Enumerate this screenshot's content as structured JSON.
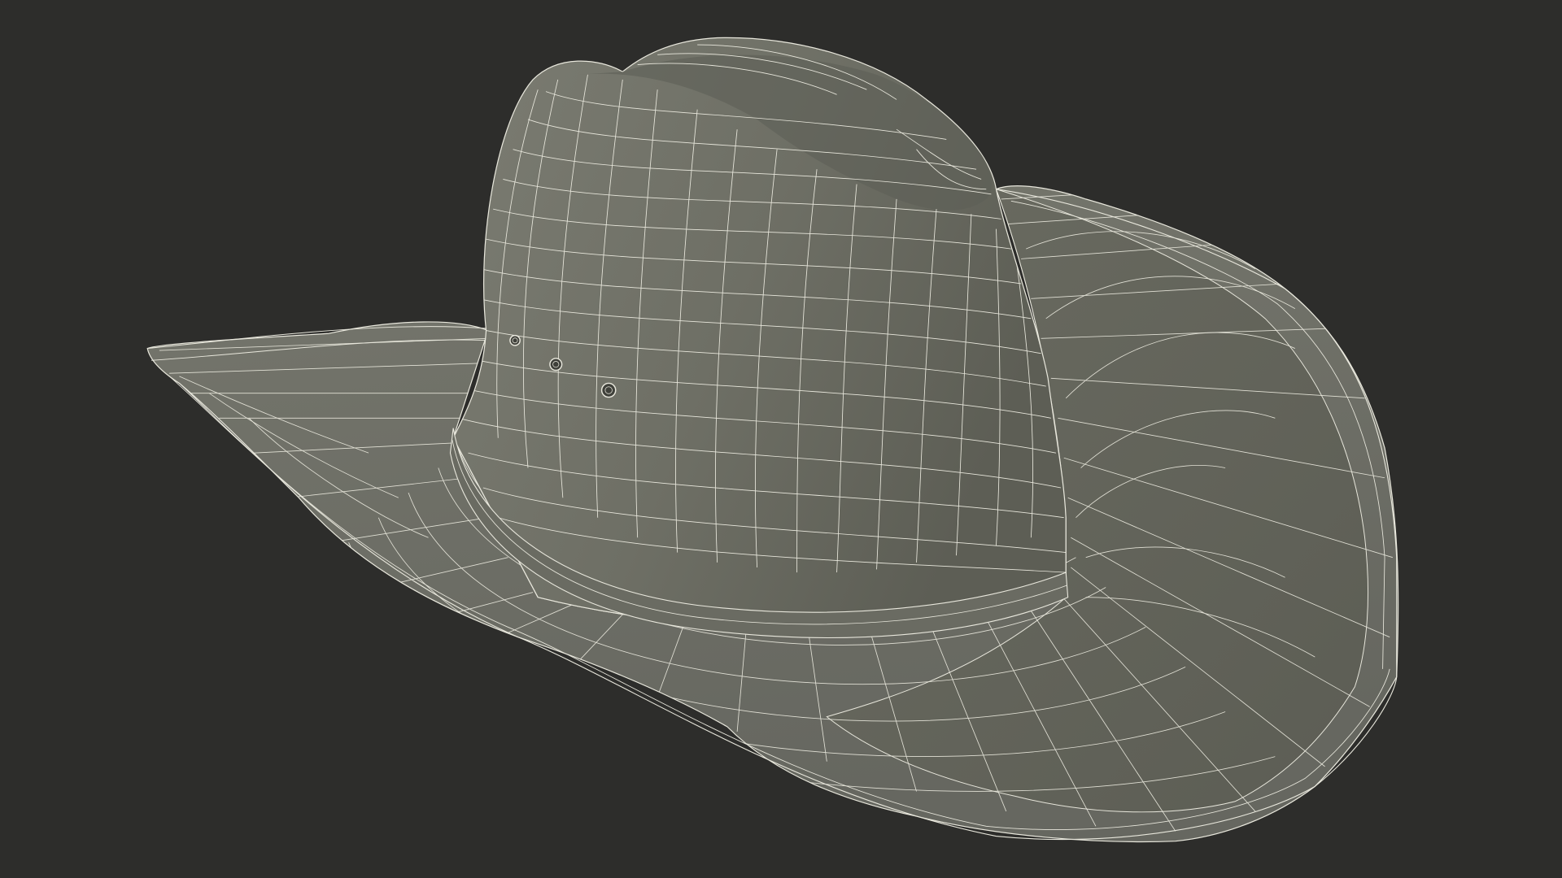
{
  "scene": {
    "subject_icon": "wireframe-cowboy-hat-icon",
    "colors": {
      "background": "#2d2d2b",
      "surface_light": "#7a7b70",
      "surface_mid": "#6b6c62",
      "surface_dark": "#505148",
      "wire": "#e8e7dc"
    }
  }
}
